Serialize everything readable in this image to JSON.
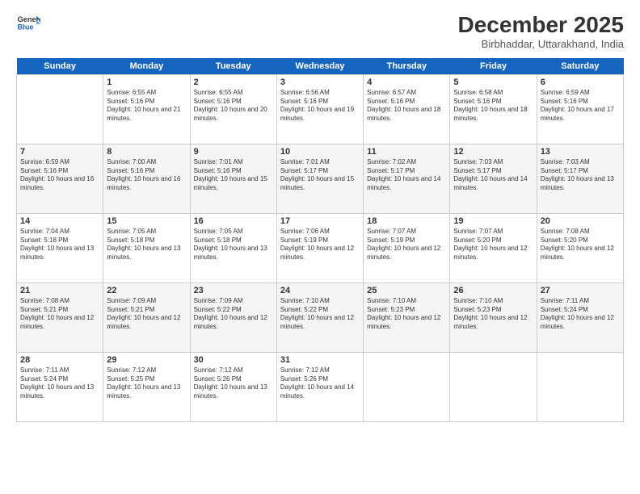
{
  "header": {
    "logo_line1": "General",
    "logo_line2": "Blue",
    "month": "December 2025",
    "location": "Birbhaddar, Uttarakhand, India"
  },
  "days": [
    "Sunday",
    "Monday",
    "Tuesday",
    "Wednesday",
    "Thursday",
    "Friday",
    "Saturday"
  ],
  "weeks": [
    [
      {
        "date": "",
        "sunrise": "",
        "sunset": "",
        "daylight": ""
      },
      {
        "date": "1",
        "sunrise": "6:55 AM",
        "sunset": "5:16 PM",
        "daylight": "10 hours and 21 minutes."
      },
      {
        "date": "2",
        "sunrise": "6:55 AM",
        "sunset": "5:16 PM",
        "daylight": "10 hours and 20 minutes."
      },
      {
        "date": "3",
        "sunrise": "6:56 AM",
        "sunset": "5:16 PM",
        "daylight": "10 hours and 19 minutes."
      },
      {
        "date": "4",
        "sunrise": "6:57 AM",
        "sunset": "5:16 PM",
        "daylight": "10 hours and 18 minutes."
      },
      {
        "date": "5",
        "sunrise": "6:58 AM",
        "sunset": "5:16 PM",
        "daylight": "10 hours and 18 minutes."
      },
      {
        "date": "6",
        "sunrise": "6:59 AM",
        "sunset": "5:16 PM",
        "daylight": "10 hours and 17 minutes."
      }
    ],
    [
      {
        "date": "7",
        "sunrise": "6:59 AM",
        "sunset": "5:16 PM",
        "daylight": "10 hours and 16 minutes."
      },
      {
        "date": "8",
        "sunrise": "7:00 AM",
        "sunset": "5:16 PM",
        "daylight": "10 hours and 16 minutes."
      },
      {
        "date": "9",
        "sunrise": "7:01 AM",
        "sunset": "5:16 PM",
        "daylight": "10 hours and 15 minutes."
      },
      {
        "date": "10",
        "sunrise": "7:01 AM",
        "sunset": "5:17 PM",
        "daylight": "10 hours and 15 minutes."
      },
      {
        "date": "11",
        "sunrise": "7:02 AM",
        "sunset": "5:17 PM",
        "daylight": "10 hours and 14 minutes."
      },
      {
        "date": "12",
        "sunrise": "7:03 AM",
        "sunset": "5:17 PM",
        "daylight": "10 hours and 14 minutes."
      },
      {
        "date": "13",
        "sunrise": "7:03 AM",
        "sunset": "5:17 PM",
        "daylight": "10 hours and 13 minutes."
      }
    ],
    [
      {
        "date": "14",
        "sunrise": "7:04 AM",
        "sunset": "5:18 PM",
        "daylight": "10 hours and 13 minutes."
      },
      {
        "date": "15",
        "sunrise": "7:05 AM",
        "sunset": "5:18 PM",
        "daylight": "10 hours and 13 minutes."
      },
      {
        "date": "16",
        "sunrise": "7:05 AM",
        "sunset": "5:18 PM",
        "daylight": "10 hours and 13 minutes."
      },
      {
        "date": "17",
        "sunrise": "7:06 AM",
        "sunset": "5:19 PM",
        "daylight": "10 hours and 12 minutes."
      },
      {
        "date": "18",
        "sunrise": "7:07 AM",
        "sunset": "5:19 PM",
        "daylight": "10 hours and 12 minutes."
      },
      {
        "date": "19",
        "sunrise": "7:07 AM",
        "sunset": "5:20 PM",
        "daylight": "10 hours and 12 minutes."
      },
      {
        "date": "20",
        "sunrise": "7:08 AM",
        "sunset": "5:20 PM",
        "daylight": "10 hours and 12 minutes."
      }
    ],
    [
      {
        "date": "21",
        "sunrise": "7:08 AM",
        "sunset": "5:21 PM",
        "daylight": "10 hours and 12 minutes."
      },
      {
        "date": "22",
        "sunrise": "7:09 AM",
        "sunset": "5:21 PM",
        "daylight": "10 hours and 12 minutes."
      },
      {
        "date": "23",
        "sunrise": "7:09 AM",
        "sunset": "5:22 PM",
        "daylight": "10 hours and 12 minutes."
      },
      {
        "date": "24",
        "sunrise": "7:10 AM",
        "sunset": "5:22 PM",
        "daylight": "10 hours and 12 minutes."
      },
      {
        "date": "25",
        "sunrise": "7:10 AM",
        "sunset": "5:23 PM",
        "daylight": "10 hours and 12 minutes."
      },
      {
        "date": "26",
        "sunrise": "7:10 AM",
        "sunset": "5:23 PM",
        "daylight": "10 hours and 12 minutes."
      },
      {
        "date": "27",
        "sunrise": "7:11 AM",
        "sunset": "5:24 PM",
        "daylight": "10 hours and 12 minutes."
      }
    ],
    [
      {
        "date": "28",
        "sunrise": "7:11 AM",
        "sunset": "5:24 PM",
        "daylight": "10 hours and 13 minutes."
      },
      {
        "date": "29",
        "sunrise": "7:12 AM",
        "sunset": "5:25 PM",
        "daylight": "10 hours and 13 minutes."
      },
      {
        "date": "30",
        "sunrise": "7:12 AM",
        "sunset": "5:26 PM",
        "daylight": "10 hours and 13 minutes."
      },
      {
        "date": "31",
        "sunrise": "7:12 AM",
        "sunset": "5:26 PM",
        "daylight": "10 hours and 14 minutes."
      },
      {
        "date": "",
        "sunrise": "",
        "sunset": "",
        "daylight": ""
      },
      {
        "date": "",
        "sunrise": "",
        "sunset": "",
        "daylight": ""
      },
      {
        "date": "",
        "sunrise": "",
        "sunset": "",
        "daylight": ""
      }
    ]
  ]
}
